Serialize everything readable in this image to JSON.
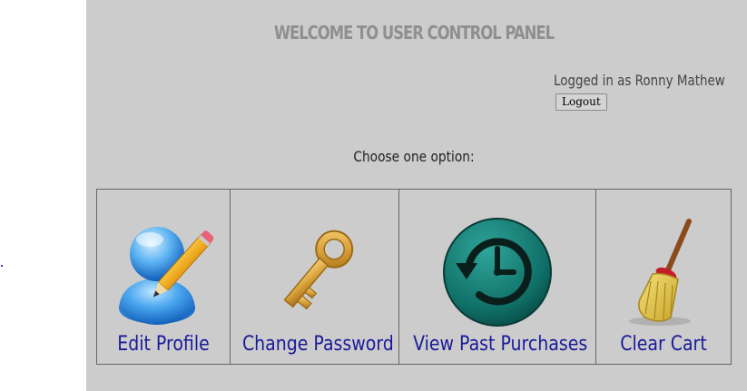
{
  "header": {
    "title": "WELCOME TO USER CONTROL PANEL"
  },
  "session": {
    "logged_in_text": "Logged in as Ronny Mathew",
    "logout_label": "Logout"
  },
  "prompt": "Choose one option:",
  "options": [
    {
      "label": "Edit Profile",
      "icon": "user-edit-icon"
    },
    {
      "label": "Change Password",
      "icon": "key-icon"
    },
    {
      "label": "View Past Purchases",
      "icon": "history-clock-icon"
    },
    {
      "label": "Clear Cart",
      "icon": "broom-icon"
    }
  ],
  "colors": {
    "panel_background": "#cccccc",
    "link_text": "#1a1a99",
    "title_text": "#8f8f8f"
  }
}
